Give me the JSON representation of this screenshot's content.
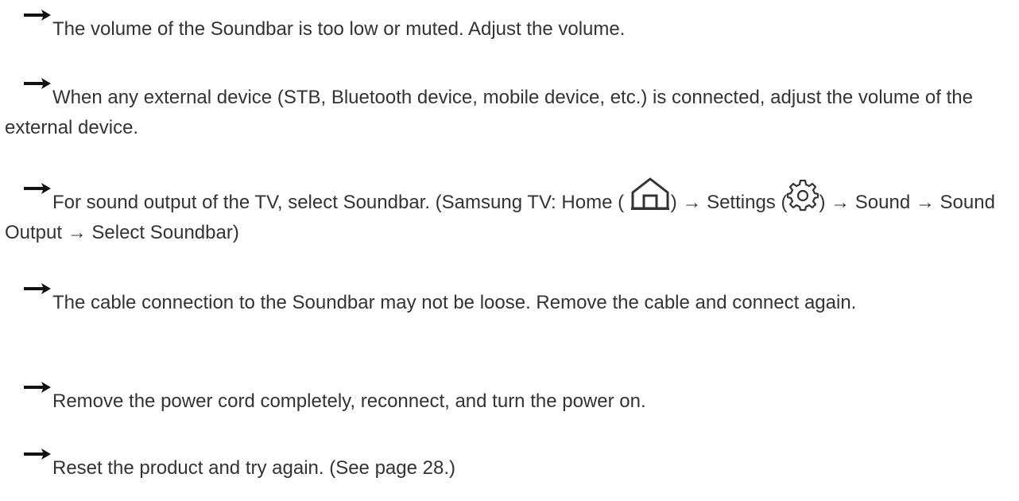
{
  "items": [
    {
      "icon": "right-arrow-icon",
      "text": "The volume of the Soundbar is too low or muted. Adjust the volume."
    },
    {
      "icon": "right-arrow-icon",
      "text": "When any external device (STB, Bluetooth device, mobile device, etc.) is connected, adjust the volume of the external device."
    },
    {
      "icon": "right-arrow-icon",
      "part_a": "For sound output of the TV, select Soundbar. (Samsung TV: Home (",
      "part_b": ") → Settings (",
      "part_c": ") → Sound → Sound Output → Select Soundbar)",
      "inline_icons": [
        "home-icon",
        "gear-icon"
      ]
    },
    {
      "icon": "right-arrow-icon",
      "text": "The cable connection to the Soundbar may not be loose. Remove the cable and connect again."
    },
    {
      "icon": "right-arrow-icon",
      "text": "Remove the power cord completely, reconnect, and turn the power on."
    },
    {
      "icon": "right-arrow-icon",
      "text": "Reset the product and try again. (See page 28.)"
    }
  ],
  "colors": {
    "text": "#333333",
    "arrow": "#111111",
    "icon_stroke": "#333333"
  }
}
